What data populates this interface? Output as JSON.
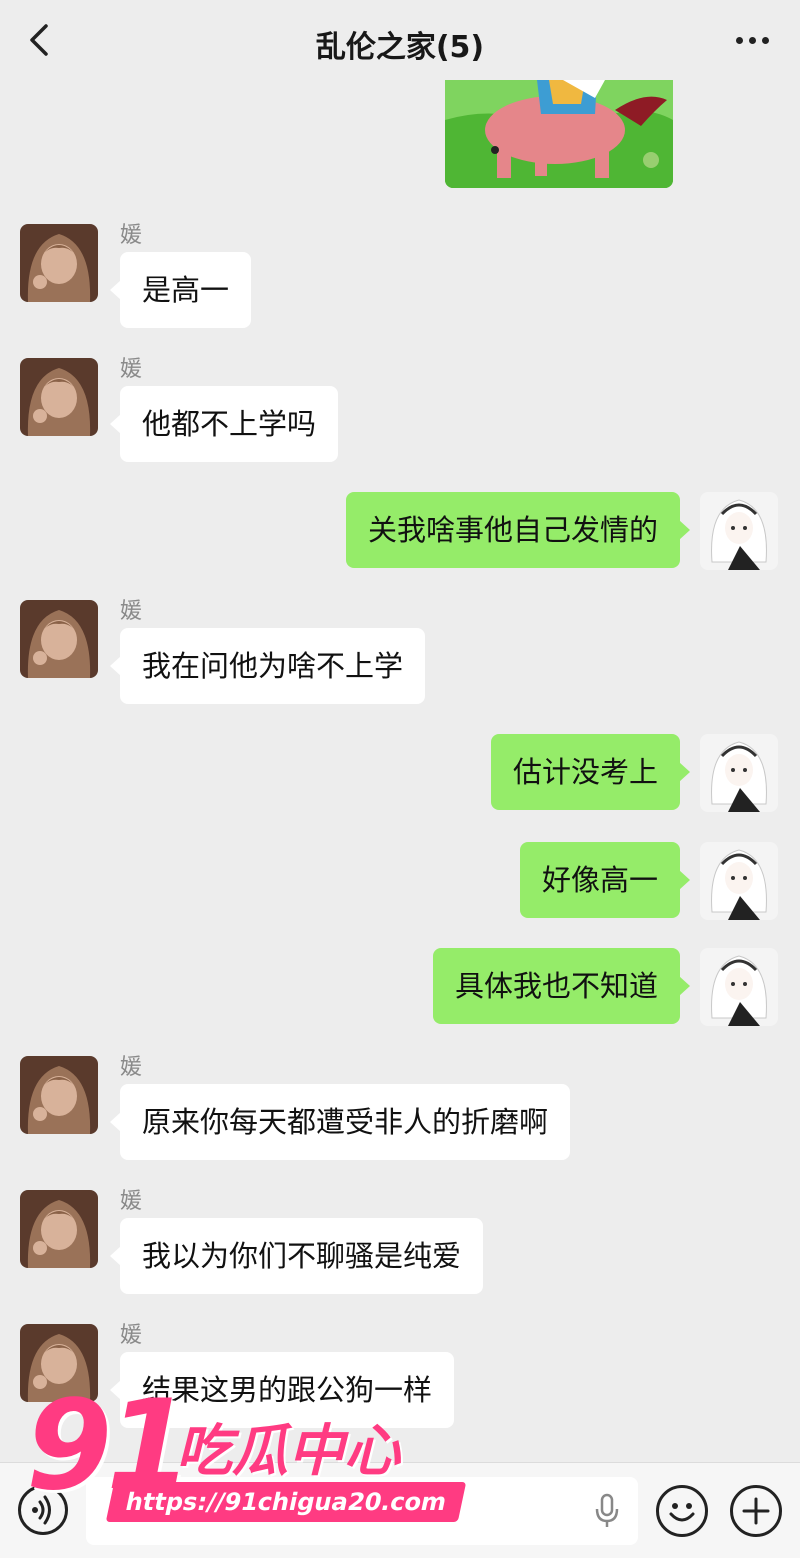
{
  "header": {
    "title": "乱伦之家(5)",
    "back_icon": "chevron-left-icon",
    "more_icon": "more-dots-icon"
  },
  "messages": [
    {
      "side": "left",
      "sender": "媛",
      "text": "是高一"
    },
    {
      "side": "left",
      "sender": "媛",
      "text": "他都不上学吗"
    },
    {
      "side": "right",
      "text": "关我啥事他自己发情的"
    },
    {
      "side": "left",
      "sender": "媛",
      "text": "我在问他为啥不上学"
    },
    {
      "side": "right",
      "text": "估计没考上"
    },
    {
      "side": "right",
      "text": "好像高一"
    },
    {
      "side": "right",
      "text": "具体我也不知道"
    },
    {
      "side": "left",
      "sender": "媛",
      "text": "原来你每天都遭受非人的折磨啊"
    },
    {
      "side": "left",
      "sender": "媛",
      "text": "我以为你们不聊骚是纯爱"
    },
    {
      "side": "left",
      "sender": "媛",
      "text": "结果这男的跟公狗一样"
    }
  ],
  "inputbar": {
    "voice_icon": "voice-icon",
    "mic_icon": "mic-icon",
    "emoji_icon": "emoji-icon",
    "plus_icon": "plus-icon"
  },
  "watermark": {
    "number": "91",
    "name": "吃瓜中心",
    "url": "https://91chigua20.com"
  },
  "colors": {
    "background": "#ededed",
    "incoming_bubble": "#ffffff",
    "outgoing_bubble": "#95ec69",
    "watermark": "#ff3b82"
  }
}
